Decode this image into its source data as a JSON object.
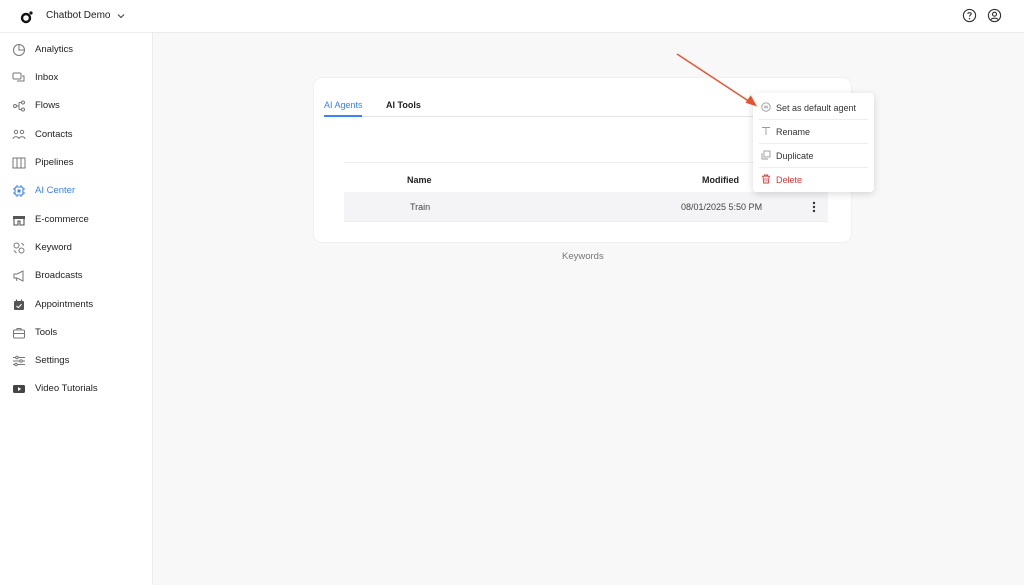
{
  "app": {
    "workspace_name": "Chatbot Demo"
  },
  "header": {
    "help_icon": "help-circle-icon",
    "profile_icon": "user-circle-icon"
  },
  "sidebar": {
    "items": [
      {
        "label": "Analytics",
        "icon": "pie-chart-icon"
      },
      {
        "label": "Inbox",
        "icon": "chat-bubbles-icon"
      },
      {
        "label": "Flows",
        "icon": "flow-icon"
      },
      {
        "label": "Contacts",
        "icon": "contacts-icon"
      },
      {
        "label": "Pipelines",
        "icon": "columns-icon"
      },
      {
        "label": "AI Center",
        "icon": "chip-icon"
      },
      {
        "label": "E-commerce",
        "icon": "store-icon"
      },
      {
        "label": "Keyword",
        "icon": "keyword-icon"
      },
      {
        "label": "Broadcasts",
        "icon": "megaphone-icon"
      },
      {
        "label": "Appointments",
        "icon": "calendar-icon"
      },
      {
        "label": "Tools",
        "icon": "toolbox-icon"
      },
      {
        "label": "Settings",
        "icon": "sliders-icon"
      },
      {
        "label": "Video Tutorials",
        "icon": "video-play-icon"
      }
    ],
    "active_index": 5
  },
  "main": {
    "tabs": [
      {
        "label": "AI Agents",
        "active": true
      },
      {
        "label": "AI Tools",
        "active": false
      }
    ],
    "table": {
      "columns": [
        "Name",
        "Modified"
      ],
      "rows": [
        {
          "name": "Train",
          "modified": "08/01/2025 5:50 PM"
        }
      ]
    },
    "footer_label": "Keywords"
  },
  "context_menu": {
    "items": [
      {
        "label": "Set as default agent",
        "icon": "default-agent-icon"
      },
      {
        "label": "Rename",
        "icon": "text-t-icon"
      },
      {
        "label": "Duplicate",
        "icon": "duplicate-icon"
      },
      {
        "label": "Delete",
        "icon": "trash-icon"
      }
    ]
  },
  "colors": {
    "accent": "#3b82f6",
    "danger": "#d93a3a",
    "annotation_arrow": "#e8532f"
  }
}
